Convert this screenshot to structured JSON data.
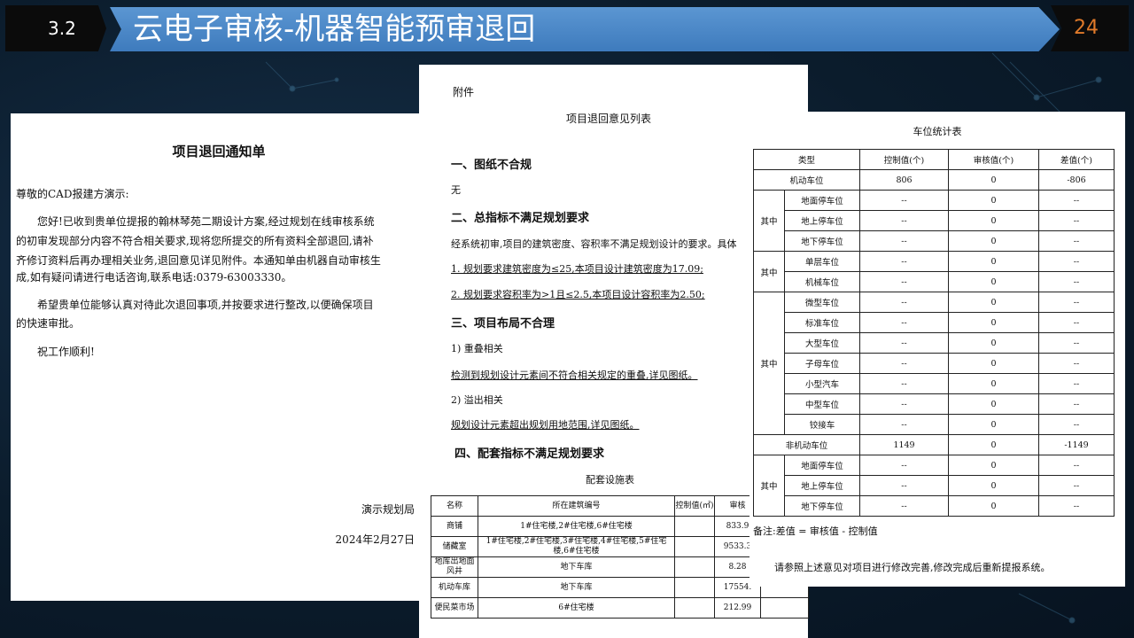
{
  "header": {
    "section_number": "3.2",
    "title": "云电子审核-机器智能预审退回",
    "page_number": "24",
    "colors": {
      "bar": "#4a88c8",
      "number_box": "#0b0b0b",
      "page_number": "#e07a2a"
    }
  },
  "notice": {
    "title": "项目退回通知单",
    "salutation": "尊敬的CAD报建方演示:",
    "para1_lines": [
      "您好!已收到贵单位提报的翰林琴苑二期设计方案,经过规划在线审核系统",
      "的初审发现部分内容不符合相关要求,现将您所提交的所有资料全部退回,请补",
      "齐修订资料后再办理相关业务,退回意见详见附件。本通知单由机器自动审核生",
      "成,如有疑问请进行电话咨询,联系电话:0379-63003330。"
    ],
    "para2_lines": [
      "希望贵单位能够认真对待此次退回事项,并按要求进行整改,以便确保项目",
      "的快速审批。"
    ],
    "closing": "祝工作顺利!",
    "org": "演示规划局",
    "date": "2024年2月27日"
  },
  "attachment": {
    "label": "附件",
    "title": "项目退回意见列表",
    "s1": "一、图纸不合规",
    "s1_body": "无",
    "s2": "二、总指标不满足规划要求",
    "s2_intro": "经系统初审,项目的建筑密度、容积率不满足规划设计的要求。具体",
    "s2_item1": "1. 规划要求建筑密度为≤25,本项目设计建筑密度为17.09;",
    "s2_item2": "2. 规划要求容积率为>1且≤2.5,本项目设计容积率为2.50;",
    "s3": "三、项目布局不合理",
    "s3_sub1": "1) 重叠相关",
    "s3_sub1_body": "检测到规划设计元素间不符合相关规定的重叠,详见图纸。",
    "s3_sub2": "2) 溢出相关",
    "s3_sub2_body": "规划设计元素超出规划用地范围,详见图纸。",
    "s4": "四、配套指标不满足规划要求",
    "facility_table": {
      "title": "配套设施表",
      "headers": [
        "名称",
        "所在建筑编号",
        "控制值(㎡)",
        "审核"
      ],
      "rows": [
        [
          "商铺",
          "1#住宅楼,2#住宅楼,6#住宅楼",
          "",
          "833.9"
        ],
        [
          "储藏室",
          "1#住宅楼,2#住宅楼,3#住宅楼,4#住宅楼,5#住宅楼,6#住宅楼",
          "",
          "9533.3"
        ],
        [
          "地库出地面风井",
          "地下车库",
          "",
          "8.28"
        ],
        [
          "机动车库",
          "地下车库",
          "",
          "17554."
        ],
        [
          "便民菜市场",
          "6#住宅楼",
          "",
          "212.99"
        ]
      ]
    }
  },
  "parking": {
    "title": "车位统计表",
    "headers": [
      "类型",
      "控制值(个)",
      "审核值(个)",
      "差值(个)"
    ],
    "rows": [
      {
        "group": "",
        "name": "机动车位",
        "control": "806",
        "review": "0",
        "diff": "-806"
      },
      {
        "group": "其中",
        "name": "地面停车位",
        "control": "--",
        "review": "0",
        "diff": "--"
      },
      {
        "group": "",
        "name": "地上停车位",
        "control": "--",
        "review": "0",
        "diff": "--"
      },
      {
        "group": "",
        "name": "地下停车位",
        "control": "--",
        "review": "0",
        "diff": "--"
      },
      {
        "group": "其中",
        "name": "单层车位",
        "control": "--",
        "review": "0",
        "diff": "--"
      },
      {
        "group": "",
        "name": "机械车位",
        "control": "--",
        "review": "0",
        "diff": "--"
      },
      {
        "group": "其中",
        "name": "微型车位",
        "control": "--",
        "review": "0",
        "diff": "--"
      },
      {
        "group": "",
        "name": "标准车位",
        "control": "--",
        "review": "0",
        "diff": "--"
      },
      {
        "group": "",
        "name": "大型车位",
        "control": "--",
        "review": "0",
        "diff": "--"
      },
      {
        "group": "",
        "name": "子母车位",
        "control": "--",
        "review": "0",
        "diff": "--"
      },
      {
        "group": "",
        "name": "小型汽车",
        "control": "--",
        "review": "0",
        "diff": "--"
      },
      {
        "group": "",
        "name": "中型车位",
        "control": "--",
        "review": "0",
        "diff": "--"
      },
      {
        "group": "",
        "name": "铰接车",
        "control": "--",
        "review": "0",
        "diff": "--"
      },
      {
        "group": "",
        "name": "非机动车位",
        "control": "1149",
        "review": "0",
        "diff": "-1149"
      },
      {
        "group": "其中",
        "name": "地面停车位",
        "control": "--",
        "review": "0",
        "diff": "--"
      },
      {
        "group": "",
        "name": "地上停车位",
        "control": "--",
        "review": "0",
        "diff": "--"
      },
      {
        "group": "",
        "name": "地下停车位",
        "control": "--",
        "review": "0",
        "diff": "--"
      }
    ],
    "note": "备注:差值 = 审核值 - 控制值",
    "footer": "请参照上述意见对项目进行修改完善,修改完成后重新提报系统。"
  }
}
